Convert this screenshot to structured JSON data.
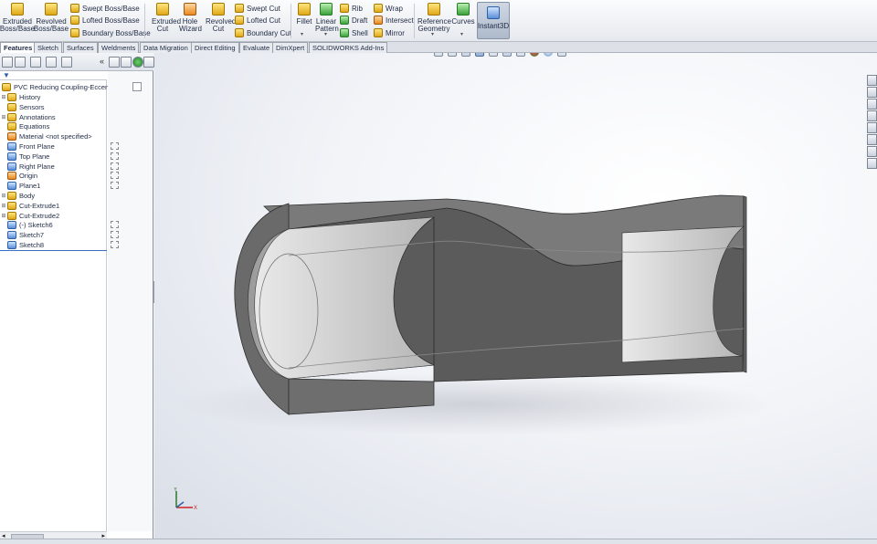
{
  "ribbon": {
    "extruded_boss": "Extruded Boss/Base",
    "revolved_boss": "Revolved Boss/Base",
    "swept_boss": "Swept Boss/Base",
    "lofted_boss": "Lofted Boss/Base",
    "boundary_boss": "Boundary Boss/Base",
    "extruded_cut": "Extruded Cut",
    "hole_wizard": "Hole Wizard",
    "revolved_cut": "Revolved Cut",
    "swept_cut": "Swept Cut",
    "lofted_cut": "Lofted Cut",
    "boundary_cut": "Boundary Cut",
    "fillet": "Fillet",
    "linear_pattern": "Linear Pattern",
    "rib": "Rib",
    "draft": "Draft",
    "shell": "Shell",
    "wrap": "Wrap",
    "intersect": "Intersect",
    "mirror": "Mirror",
    "reference_geometry": "Reference Geometry",
    "curves": "Curves",
    "instant3d": "Instant3D"
  },
  "tabs": [
    {
      "label": "Features",
      "active": true
    },
    {
      "label": "Sketch"
    },
    {
      "label": "Surfaces"
    },
    {
      "label": "Weldments"
    },
    {
      "label": "Data Migration"
    },
    {
      "label": "Direct Editing"
    },
    {
      "label": "Evaluate"
    },
    {
      "label": "DimXpert"
    },
    {
      "label": "SOLIDWORKS Add-Ins"
    }
  ],
  "tree": {
    "root": "PVC Reducing Coupling-Eccentric",
    "items": [
      {
        "label": "History"
      },
      {
        "label": "Sensors"
      },
      {
        "label": "Annotations"
      },
      {
        "label": "Equations"
      },
      {
        "label": "Material <not specified>"
      },
      {
        "label": "Front Plane"
      },
      {
        "label": "Top Plane"
      },
      {
        "label": "Right Plane"
      },
      {
        "label": "Origin"
      },
      {
        "label": "Plane1"
      },
      {
        "label": "Body"
      },
      {
        "label": "Cut-Extrude1"
      },
      {
        "label": "Cut-Extrude2"
      },
      {
        "label": "(-) Sketch6"
      },
      {
        "label": "Sketch7"
      },
      {
        "label": "Sketch8"
      }
    ]
  },
  "triad": {
    "x": "X",
    "y": "Y"
  },
  "colors": {
    "part_face": "#5b5b5b",
    "accent": "#3b6fbf"
  }
}
